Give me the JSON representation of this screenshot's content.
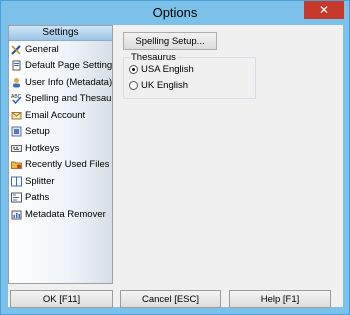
{
  "window": {
    "title": "Options",
    "close_glyph": "✕"
  },
  "sidebar": {
    "header": "Settings",
    "items": [
      {
        "label": "General",
        "icon": "wrench-ruler-icon"
      },
      {
        "label": "Default Page Settings",
        "icon": "page-settings-icon"
      },
      {
        "label": "User Info (Metadata)",
        "icon": "user-icon"
      },
      {
        "label": "Spelling and Thesaurus",
        "icon": "abc-check-icon"
      },
      {
        "label": "Email Account",
        "icon": "envelope-icon"
      },
      {
        "label": "Setup",
        "icon": "setup-icon"
      },
      {
        "label": "Hotkeys",
        "icon": "keyboard-icon"
      },
      {
        "label": "Recently Used Files",
        "icon": "folder-icon"
      },
      {
        "label": "Splitter",
        "icon": "splitter-icon"
      },
      {
        "label": "Paths",
        "icon": "paths-icon"
      },
      {
        "label": "Metadata Remover",
        "icon": "metadata-remover-icon"
      }
    ]
  },
  "main": {
    "spelling_setup_label": "Spelling Setup...",
    "thesaurus": {
      "legend": "Thesaurus",
      "options": [
        {
          "label": "USA English",
          "selected": true
        },
        {
          "label": "UK English",
          "selected": false
        }
      ]
    }
  },
  "footer": {
    "ok_label": "OK [F11]",
    "cancel_label": "Cancel [ESC]",
    "help_label": "Help [F1]"
  }
}
